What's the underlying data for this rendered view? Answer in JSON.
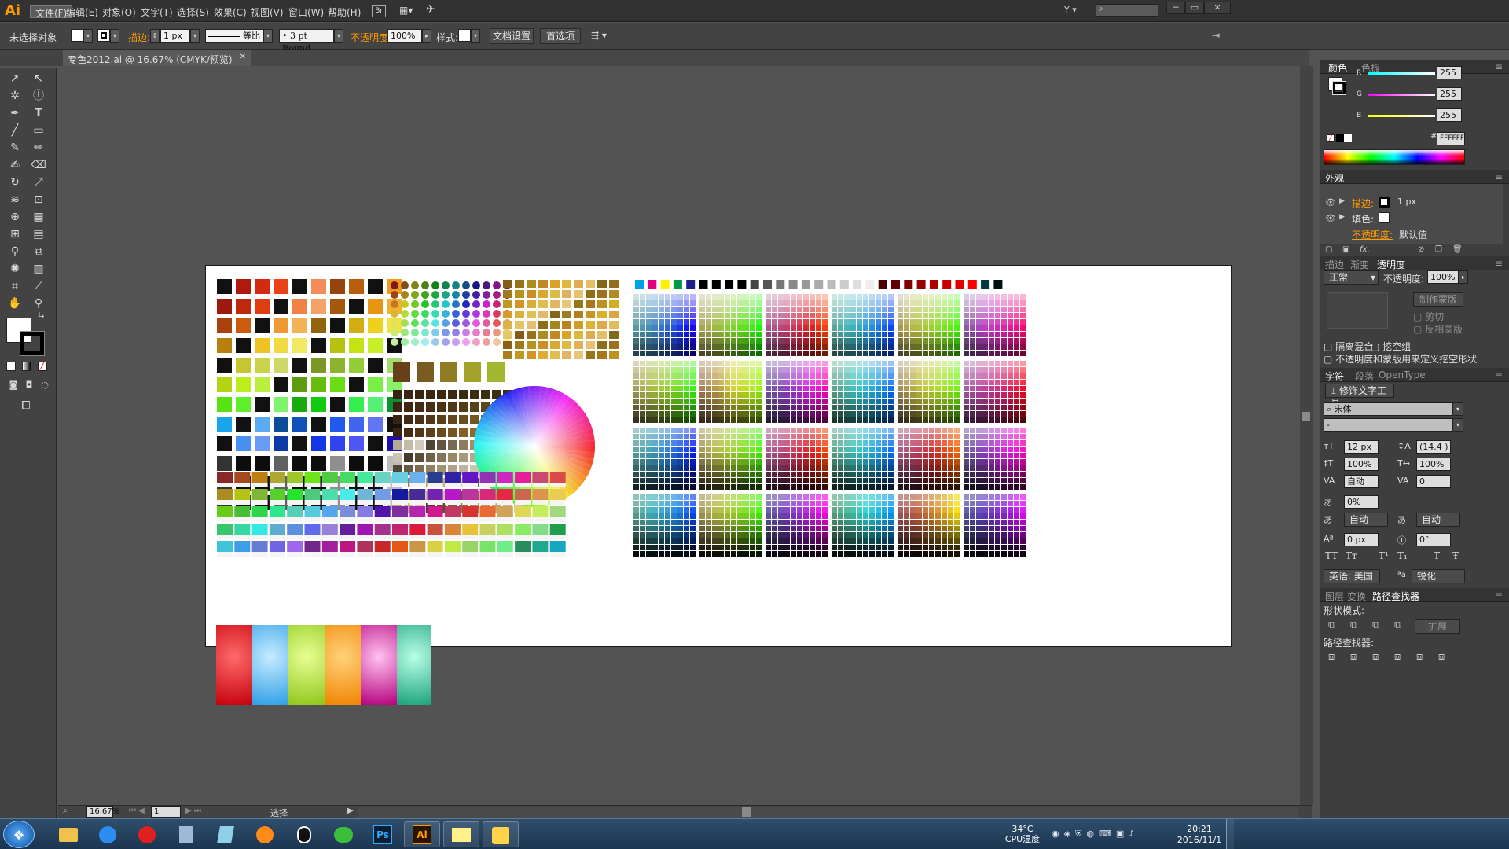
{
  "app": {
    "logo": "Ai",
    "brand_color": "#ff9a00",
    "workspace": "Y"
  },
  "menubar": {
    "items": [
      "文件(F)",
      "编辑(E)",
      "对象(O)",
      "文字(T)",
      "选择(S)",
      "效果(C)",
      "视图(V)",
      "窗口(W)",
      "帮助(H)"
    ],
    "bridge_label": "Br"
  },
  "control": {
    "selection": "未选择对象",
    "stroke_label": "描边:",
    "stroke_width": "1 px",
    "profile": "等比",
    "brush": "3 pt Round",
    "opacity_label": "不透明度:",
    "opacity_value": "100%",
    "style_label": "样式:",
    "doc_setup": "文档设置",
    "preferences": "首选项"
  },
  "document": {
    "tab_title": "专色2012.ai @ 16.67% (CMYK/预览)"
  },
  "color_panel": {
    "tabs": [
      "颜色",
      "色板"
    ],
    "channels": [
      {
        "name": "R",
        "value": "255"
      },
      {
        "name": "G",
        "value": "255"
      },
      {
        "name": "B",
        "value": "255"
      }
    ],
    "hex_label": "#",
    "hex": "FFFFFF"
  },
  "appearance_panel": {
    "title": "外观",
    "rows": [
      {
        "label": "描边:",
        "value": "1 px"
      },
      {
        "label": "填色:",
        "value": ""
      },
      {
        "label": "不透明度:",
        "value": "默认值"
      }
    ],
    "fx": "fx."
  },
  "transparency_panel": {
    "tabs": [
      "描边",
      "渐变",
      "透明度"
    ],
    "blend_mode": "正常",
    "opacity_label": "不透明度:",
    "opacity_value": "100%",
    "make_mask": "制作蒙版",
    "clip": "剪切",
    "invert_mask": "反相蒙版",
    "isolate": "隔离混合",
    "knockout": "挖空组",
    "opacity_mask_define": "不透明度和蒙版用来定义挖空形状"
  },
  "character_panel": {
    "tabs": [
      "字符",
      "段落",
      "OpenType"
    ],
    "touch_tool": "修饰文字工具",
    "font": "宋体",
    "style": "-",
    "size": "12 px",
    "leading": "(14.4 )",
    "hscale": "100%",
    "vscale": "100%",
    "kerning": "自动",
    "tracking": "0",
    "tsume": "0%",
    "aki_left": "自动",
    "aki_right": "自动",
    "baseline": "0 px",
    "rotation": "0°",
    "language": "英语: 美国",
    "antialias": "锐化",
    "type_buttons": [
      "TT",
      "Tт",
      "T¹",
      "T₁",
      "T",
      "Ŧ"
    ]
  },
  "pathfinder_panel": {
    "tabs": [
      "图层",
      "变换",
      "路径查找器"
    ],
    "shape_modes": "形状模式:",
    "expand": "扩展",
    "pathfinders": "路径查找器:"
  },
  "statusbar": {
    "zoom": "16.67%",
    "page": "1",
    "tool": "选择"
  },
  "taskbar": {
    "temp": "34°C",
    "cpu_label": "CPU温度",
    "time": "20:21",
    "date": "2016/11/1",
    "ps_label": "Ps",
    "ai_label": "Ai"
  }
}
